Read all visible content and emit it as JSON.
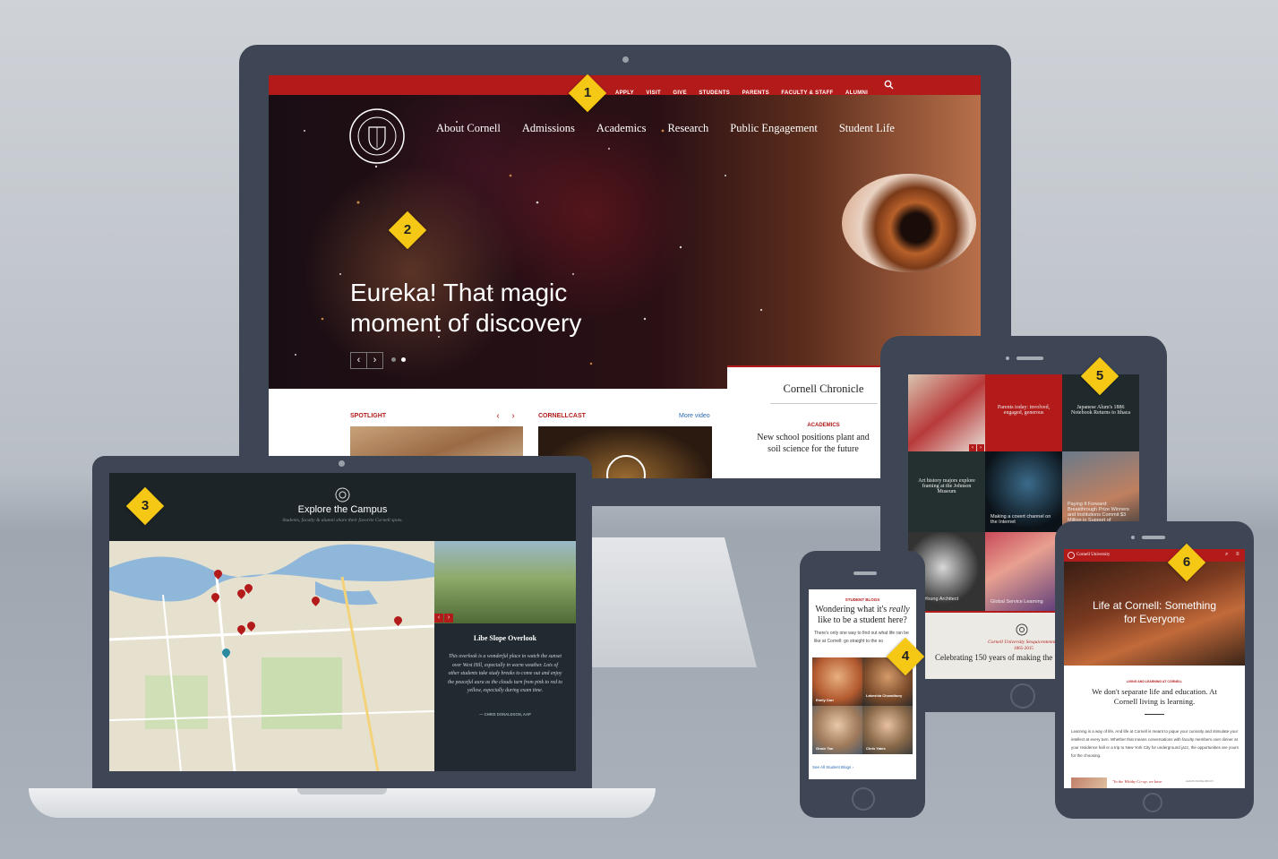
{
  "desktop": {
    "utility_nav": [
      "APPLY",
      "VISIT",
      "GIVE",
      "STUDENTS",
      "PARENTS",
      "FACULTY & STAFF",
      "ALUMNI"
    ],
    "main_nav": [
      "About Cornell",
      "Admissions",
      "Academics",
      "Research",
      "Public Engagement",
      "Student Life"
    ],
    "hero_line1": "Eureka! That magic",
    "hero_line2": "moment of discovery",
    "spotlight_label": "SPOTLIGHT",
    "cornellcast_label": "CORNELLCAST",
    "more_video": "More video",
    "chronicle_title": "Cornell Chronicle",
    "chronicle_category": "ACADEMICS",
    "chronicle_headline": "New school positions plant and soil science for the future"
  },
  "laptop": {
    "title": "Explore the Campus",
    "subtitle": "Students, faculty & alumni share their favorite Cornell spots.",
    "place_title": "Libe Slope Overlook",
    "place_text": "This overlook is a wonderful place to watch the sunset over West Hill, especially in warm weather. Lots of other students take study breaks to come out and enjoy the peaceful aura as the clouds turn from pink to red to yellow, especially during exam time.",
    "place_author": "— CHRIS DONALDSON, AAP"
  },
  "tablet": {
    "tile1": "Parents today: involved, engaged, generous",
    "tile2": "Japanese Alum's 1886 Notebook Returns to Ithaca",
    "tile3": "Art history majors explore framing at the Johnson Museum",
    "tile4": "Making a covert channel on the Internet",
    "tile5": "Paying It Forward: Breakthrough Prize Winners and Institutions Commit $3 Million in Support of",
    "tile6": "Alex Young Architect",
    "tile7": "Global Service Learning",
    "footer_label": "Cornell University Sesquicentennial",
    "footer_years": "1865-2015",
    "footer_text": "Celebrating 150 years of making the wo"
  },
  "phone": {
    "label": "STUDENT BLOGS",
    "title_part1": "Wondering what it's ",
    "title_em": "really",
    "title_part2": "like to be a student here?",
    "intro": "There's only one way to find out what life ran be like at Cornell: go straight to the so",
    "names": [
      "Emily Carr",
      "Lakeshia Chowdbury",
      "Grace Tan",
      "Chris Yates"
    ],
    "see_all": "See All Student Blogs ›"
  },
  "tablet2": {
    "brand": "Cornell University",
    "hero_line1": "Life at Cornell: Something",
    "hero_line2": "for Everyone",
    "section_label": "LIVING AND LEARNING AT CORNELL",
    "headline": "We don't separate life and education. At Cornell living is learning.",
    "body": "Learning is a way of life. And life at Cornell is meant to pique your curiosity and stimulate your intellect at every turn. Whether that means conversations with faculty members over dinner at your residence hall or a trip to New York City for underground jazz, the opportunities are yours for the choosing.",
    "quote": "\"In the Whitby Co-op, we have",
    "more": "LEARN MORE ABOUT..."
  },
  "markers": [
    "1",
    "2",
    "3",
    "4",
    "5",
    "6"
  ],
  "colors": {
    "cornell_red": "#b31b1b",
    "device": "#3e4554",
    "marker": "#f4c815"
  }
}
